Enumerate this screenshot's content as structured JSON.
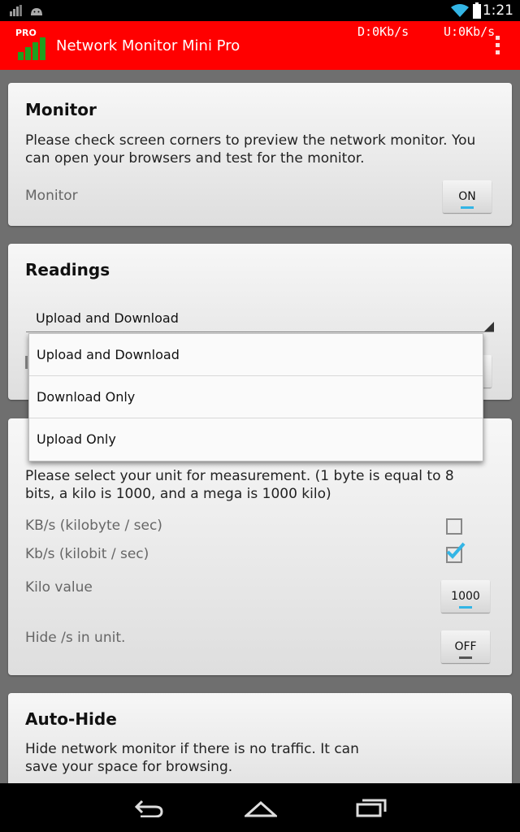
{
  "status": {
    "time": "1:21"
  },
  "app": {
    "badge": "PRO",
    "title": "Network Monitor Mini Pro",
    "download": "D:0Kb/s",
    "upload": "U:0Kb/s"
  },
  "monitor": {
    "heading": "Monitor",
    "desc": "Please check screen corners to preview the network monitor. You can open your browsers and test for the monitor.",
    "label": "Monitor",
    "toggle": "ON"
  },
  "readings": {
    "heading": "Readings",
    "selected": "Upload and Download"
  },
  "dropdown": {
    "options": [
      "Upload and Download",
      "Download Only",
      "Upload Only"
    ]
  },
  "unit": {
    "desc": "Please select your unit for measurement. (1 byte is equal to 8 bits, a kilo is 1000, and a mega is 1000 kilo)",
    "kbytes": "KB/s (kilobyte / sec)",
    "kbits": "Kb/s (kilobit / sec)",
    "kbytes_checked": false,
    "kbits_checked": true,
    "kilo_label": "Kilo value",
    "kilo_value": "1000",
    "hide_label": "Hide /s in unit.",
    "hide_toggle": "OFF"
  },
  "autohide": {
    "heading": "Auto-Hide",
    "desc": "Hide network monitor if there is no traffic. It can save your space for browsing."
  },
  "icons": [
    "signal-icon",
    "android-icon",
    "wifi-icon",
    "battery-icon",
    "overflow-menu-icon",
    "back-icon",
    "home-icon",
    "recent-apps-icon",
    "checkbox-checked-icon"
  ]
}
